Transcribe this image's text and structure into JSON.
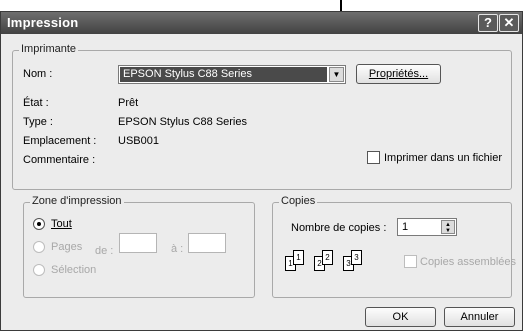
{
  "dialog": {
    "title": "Impression",
    "help_glyph": "?",
    "close_glyph": "✕"
  },
  "printer": {
    "legend": "Imprimante",
    "name_label": "Nom :",
    "name_value": "EPSON Stylus C88 Series",
    "properties_label": "Propriétés...",
    "status_label": "État :",
    "status_value": "Prêt",
    "type_label": "Type :",
    "type_value": "EPSON Stylus C88 Series",
    "location_label": "Emplacement :",
    "location_value": "USB001",
    "comment_label": "Commentaire :",
    "print_to_file_label": "Imprimer dans un fichier"
  },
  "range": {
    "legend": "Zone d'impression",
    "all_label": "Tout",
    "pages_label": "Pages",
    "from_label": "de :",
    "to_label": "à :",
    "selection_label": "Sélection"
  },
  "copies": {
    "legend": "Copies",
    "count_label": "Nombre de copies :",
    "count_value": "1",
    "collate_label": "Copies assemblées",
    "pages": [
      "1",
      "1",
      "2",
      "2",
      "3",
      "3"
    ]
  },
  "buttons": {
    "ok": "OK",
    "cancel": "Annuler"
  }
}
